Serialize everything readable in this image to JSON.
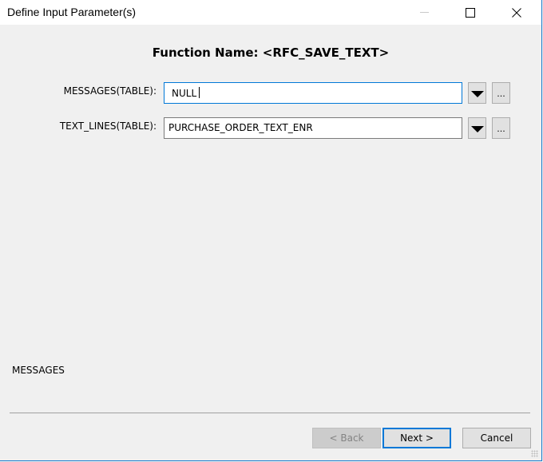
{
  "window": {
    "title": "Define Input Parameter(s)",
    "controls": {
      "minimize": "minimize-icon",
      "maximize": "maximize-icon",
      "close": "close-icon"
    }
  },
  "header": {
    "function_name": "Function Name: <RFC_SAVE_TEXT>"
  },
  "parameters": [
    {
      "label": "MESSAGES(TABLE):",
      "value": "NULL",
      "focused": true,
      "dropdown_icon": "dropdown-arrow-icon",
      "browse_label": "..."
    },
    {
      "label": "TEXT_LINES(TABLE):",
      "value": "PURCHASE_ORDER_TEXT_ENR",
      "focused": false,
      "dropdown_icon": "dropdown-arrow-icon",
      "browse_label": "..."
    }
  ],
  "description": {
    "text": "MESSAGES"
  },
  "buttons": {
    "back": "< Back",
    "next": "Next >",
    "cancel": "Cancel"
  },
  "colors": {
    "accent": "#0078d7",
    "background": "#f0f0f0",
    "titlebar": "#ffffff"
  }
}
